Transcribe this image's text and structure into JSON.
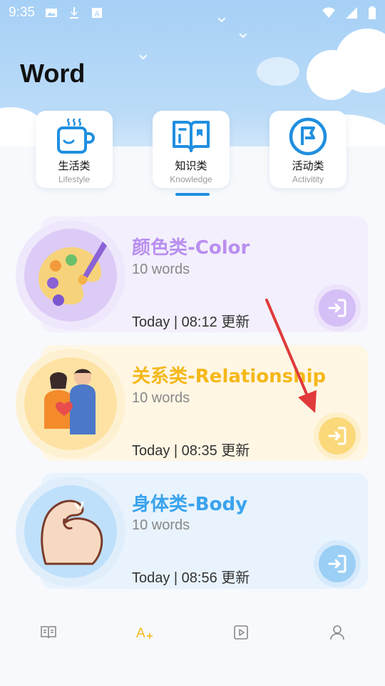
{
  "status_bar": {
    "time": "9:35",
    "icons": [
      "image-icon",
      "download-icon",
      "font-icon"
    ],
    "right_icons": [
      "wifi-icon",
      "signal-icon",
      "battery-icon"
    ]
  },
  "page": {
    "title": "Word"
  },
  "categories": [
    {
      "cn": "生活类",
      "en": "Lifestyle",
      "icon": "cup-icon"
    },
    {
      "cn": "知识类",
      "en": "Knowledge",
      "icon": "book-icon",
      "selected": true
    },
    {
      "cn": "活动类",
      "en": "Activitity",
      "icon": "flag-icon"
    }
  ],
  "cards": [
    {
      "title": "颜色类-Color",
      "count": "10 words",
      "time": "Today | 08:12 更新",
      "accent": "#b98ff0",
      "icon": "palette-icon"
    },
    {
      "title": "关系类-Relationship",
      "count": "10 words",
      "time": "Today | 08:35 更新",
      "accent": "#f5b81a",
      "icon": "couple-icon"
    },
    {
      "title": "身体类-Body",
      "count": "10 words",
      "time": "Today | 08:56 更新",
      "accent": "#3aa3ee",
      "icon": "arm-icon"
    }
  ],
  "bottom_nav": [
    {
      "icon": "book-open-icon",
      "active": false
    },
    {
      "icon": "word-add-icon",
      "active": true
    },
    {
      "icon": "video-icon",
      "active": false
    },
    {
      "icon": "profile-icon",
      "active": false
    }
  ],
  "colors": {
    "accent_blue": "#1f8fe0",
    "annotation_red": "#e03a3a"
  }
}
